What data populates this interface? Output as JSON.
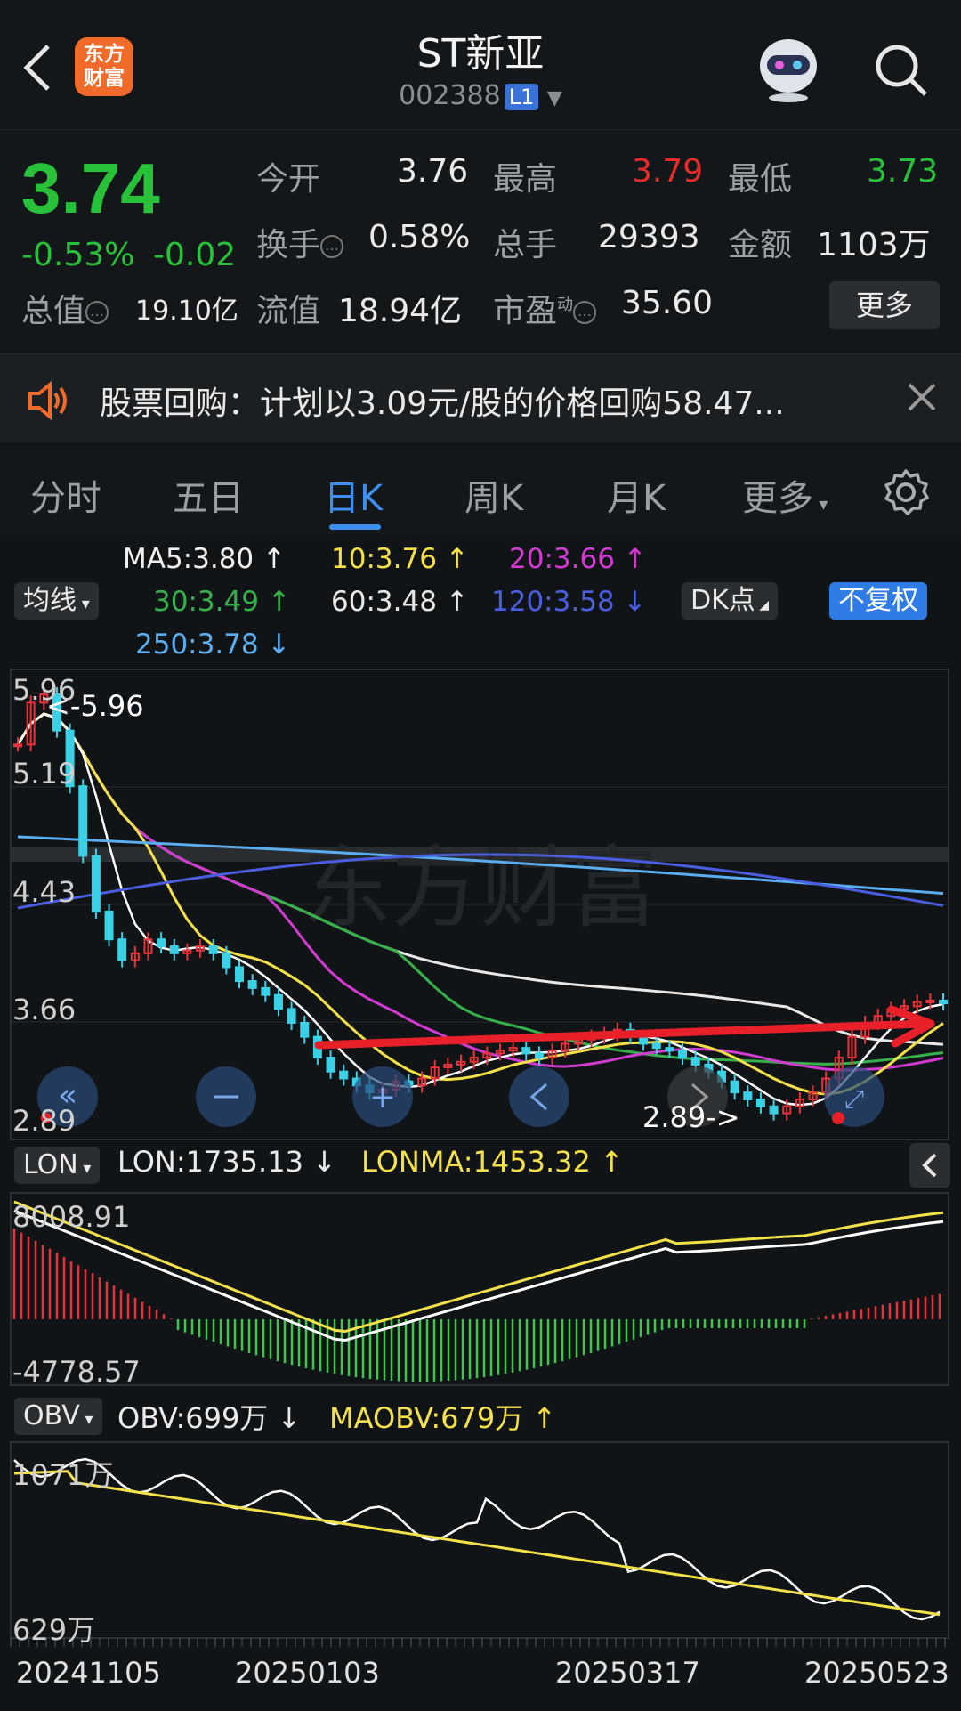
{
  "header": {
    "title": "ST新亚",
    "code": "002388",
    "level": "L1",
    "logo_text_1": "东方",
    "logo_text_2": "财富"
  },
  "quote": {
    "price": "3.74",
    "change_pct": "-0.53%",
    "change": "-0.02",
    "open_label": "今开",
    "open": "3.76",
    "high_label": "最高",
    "high": "3.79",
    "low_label": "最低",
    "low": "3.73",
    "turnover_label": "换手",
    "turnover": "0.58%",
    "volume_label": "总手",
    "volume": "29393",
    "amount_label": "金额",
    "amount": "1103万",
    "mcap_label": "总值",
    "mcap": "19.10亿",
    "float_label": "流值",
    "float": "18.94亿",
    "pe_label": "市盈",
    "pe_sup": "动",
    "pe": "35.60",
    "more": "更多"
  },
  "notice": {
    "text": "股票回购：计划以3.09元/股的价格回购58.47..."
  },
  "tabs": [
    "分时",
    "五日",
    "日K",
    "周K",
    "月K",
    "更多"
  ],
  "ma": {
    "ma5": "MA5:3.80",
    "ma10": "10:3.76",
    "ma20": "20:3.66",
    "ma30": "30:3.49",
    "ma60": "60:3.48",
    "ma120": "120:3.58",
    "ma250": "250:3.78",
    "selector": "均线",
    "dk": "DK点",
    "fq": "不复权"
  },
  "lon": {
    "selector": "LON",
    "lon": "LON:1735.13",
    "lonma": "LONMA:1453.32",
    "top": "8008.91",
    "bottom": "-4778.57"
  },
  "obv": {
    "selector": "OBV",
    "obv": "OBV:699万",
    "maobv": "MAOBV:679万",
    "top": "1071万",
    "bottom": "629万"
  },
  "price_axis": {
    "p1": "5.96",
    "p2": "5.19",
    "p3": "4.43",
    "p4": "3.66",
    "p5": "2.89",
    "high_mark": "<-5.96",
    "low_mark": "2.89->"
  },
  "dates": [
    "20241105",
    "20250103",
    "20250317",
    "20250523"
  ],
  "watermark": "东方财富",
  "chart_data": {
    "type": "line",
    "price_ylim": [
      2.89,
      5.96
    ],
    "close": [
      5.6,
      5.9,
      5.96,
      5.7,
      5.3,
      4.8,
      4.4,
      4.2,
      4.05,
      4.1,
      4.2,
      4.15,
      4.1,
      4.12,
      4.15,
      4.1,
      4.0,
      3.9,
      3.85,
      3.8,
      3.7,
      3.6,
      3.5,
      3.35,
      3.25,
      3.2,
      3.15,
      3.1,
      3.12,
      3.18,
      3.15,
      3.2,
      3.28,
      3.3,
      3.32,
      3.35,
      3.38,
      3.4,
      3.42,
      3.38,
      3.35,
      3.4,
      3.45,
      3.48,
      3.5,
      3.52,
      3.55,
      3.5,
      3.45,
      3.42,
      3.4,
      3.35,
      3.3,
      3.25,
      3.18,
      3.1,
      3.05,
      3.0,
      2.95,
      3.0,
      3.05,
      3.1,
      3.2,
      3.35,
      3.5,
      3.6,
      3.65,
      3.7,
      3.72,
      3.75,
      3.76,
      3.74
    ]
  }
}
